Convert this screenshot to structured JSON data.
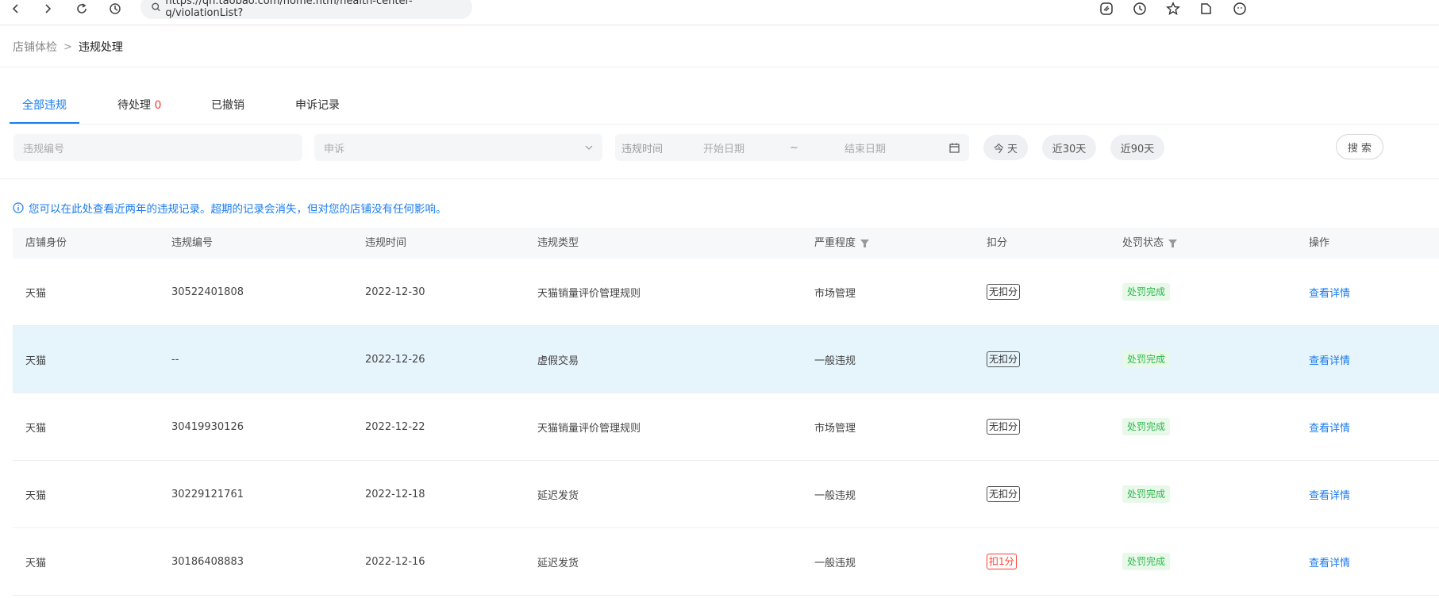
{
  "browser": {
    "url": "https://qn.taobao.com/home.htm/health-center-q/violationList?",
    "icons": [
      "back-icon",
      "forward-icon",
      "reload-icon",
      "history-icon",
      "search-icon",
      "extension-icon",
      "refresh-circle-icon",
      "star-icon",
      "folder-icon",
      "account-icon"
    ]
  },
  "breadcrumb": {
    "root": "店铺体检",
    "separator": ">",
    "current": "违规处理"
  },
  "tabs": [
    {
      "label": "全部违规",
      "count": ""
    },
    {
      "label": "待处理 ",
      "count": "0"
    },
    {
      "label": "已撤销",
      "count": ""
    },
    {
      "label": "申诉记录",
      "count": ""
    }
  ],
  "filters": {
    "violation_no_placeholder": "违规编号",
    "appeal_value": "申诉",
    "time_label": "违规时间",
    "start_placeholder": "开始日期",
    "range_sep": "~",
    "end_placeholder": "结束日期",
    "today": "今 天",
    "last30": "近30天",
    "last90": "近90天",
    "search": "搜 索"
  },
  "notice": "您可以在此处查看近两年的违规记录。超期的记录会消失，但对您的店铺没有任何影响。",
  "table": {
    "headers": [
      "店铺身份",
      "违规编号",
      "违规时间",
      "违规类型",
      "严重程度",
      "扣分",
      "处罚状态",
      "操作"
    ],
    "rows": [
      {
        "shop": "天猫",
        "no": "30522401808",
        "time": "2022-12-30",
        "type": "天猫销量评价管理规则",
        "severity": "市场管理",
        "points": "无扣分",
        "deducted": false,
        "status": "处罚完成",
        "action": "查看详情"
      },
      {
        "shop": "天猫",
        "no": "--",
        "time": "2022-12-26",
        "type": "虚假交易",
        "severity": "一般违规",
        "points": "无扣分",
        "deducted": false,
        "status": "处罚完成",
        "action": "查看详情"
      },
      {
        "shop": "天猫",
        "no": "30419930126",
        "time": "2022-12-22",
        "type": "天猫销量评价管理规则",
        "severity": "市场管理",
        "points": "无扣分",
        "deducted": false,
        "status": "处罚完成",
        "action": "查看详情"
      },
      {
        "shop": "天猫",
        "no": "30229121761",
        "time": "2022-12-18",
        "type": "延迟发货",
        "severity": "一般违规",
        "points": "无扣分",
        "deducted": false,
        "status": "处罚完成",
        "action": "查看详情"
      },
      {
        "shop": "天猫",
        "no": "30186408883",
        "time": "2022-12-16",
        "type": "延迟发货",
        "severity": "一般违规",
        "points": "扣1分",
        "deducted": true,
        "status": "处罚完成",
        "action": "查看详情"
      }
    ]
  },
  "colors": {
    "accent": "#1a7cf0",
    "danger": "#ff3b30",
    "success": "#2db84d",
    "highlight_row": "#e6f4fc"
  }
}
